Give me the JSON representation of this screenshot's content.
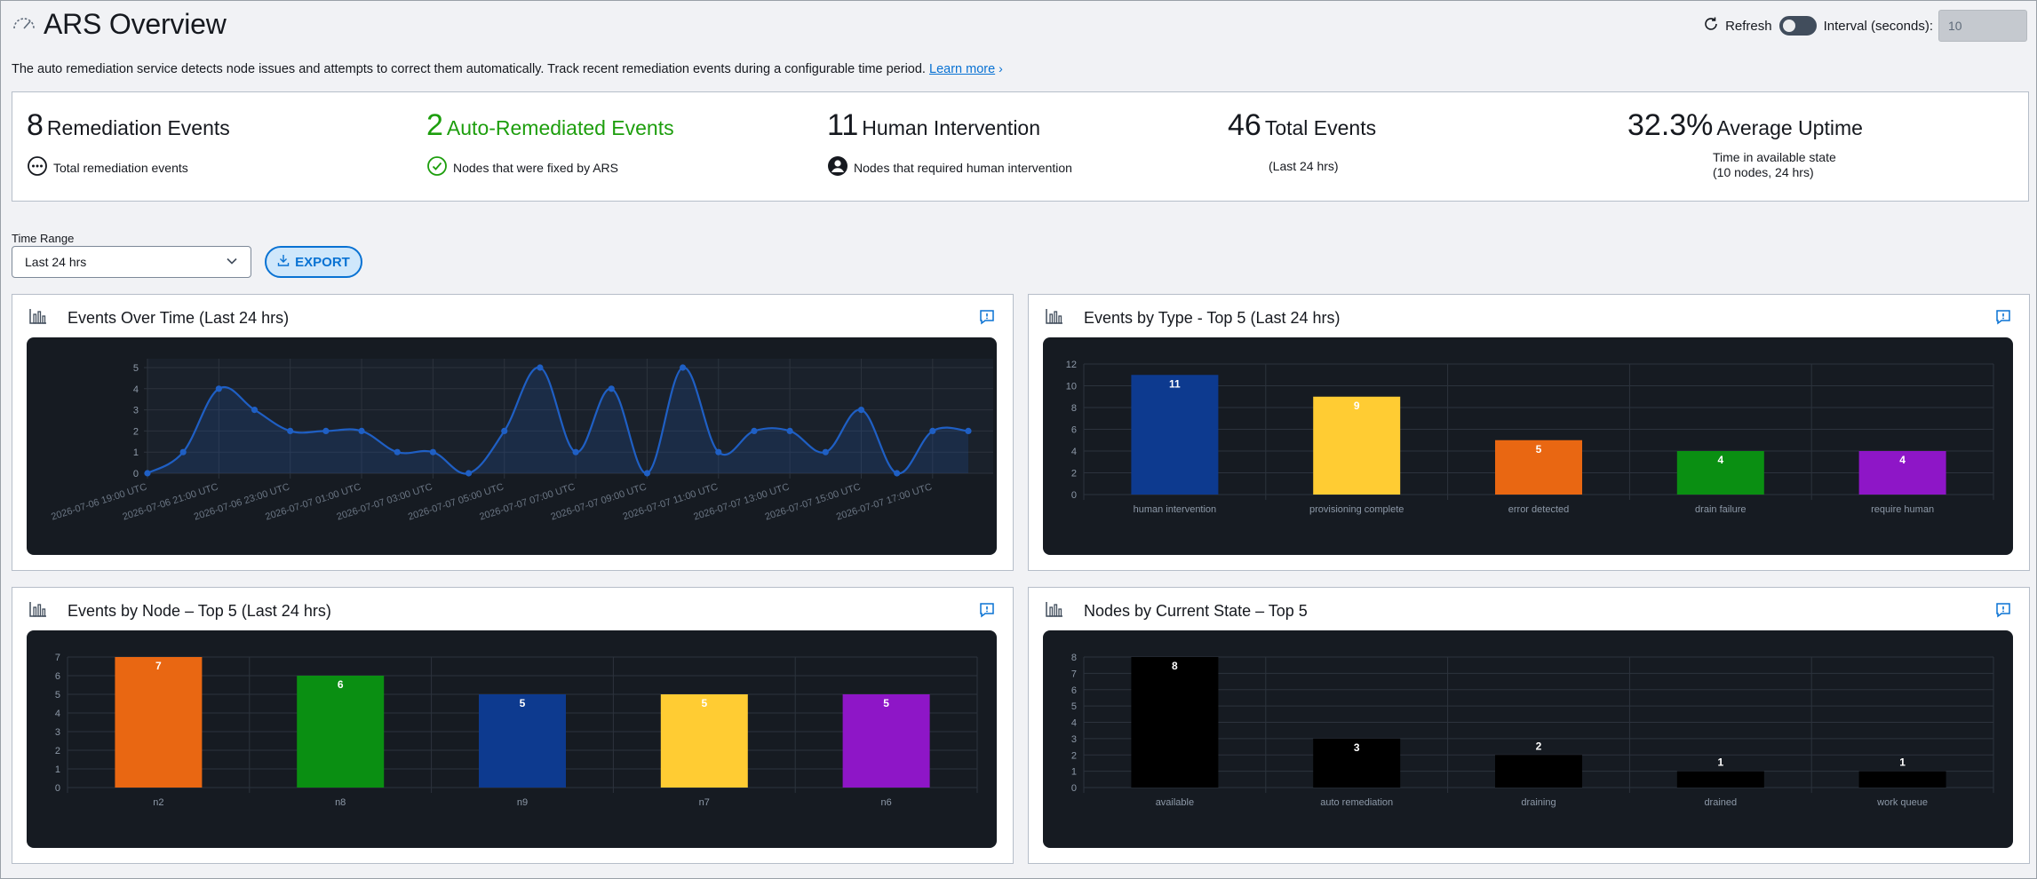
{
  "header": {
    "title": "ARS Overview",
    "refresh_label": "Refresh",
    "interval_label": "Interval (seconds):",
    "interval_value": "10",
    "description": "The auto remediation service detects node issues and attempts to correct them automatically. Track recent remediation events during a configurable time period.",
    "learn_more": "Learn more",
    "learn_more_chevron": "›"
  },
  "summary": {
    "remediation": {
      "count": "8",
      "label": "Remediation Events",
      "sub": "Total remediation events",
      "icon": "ellipsis-circle-icon"
    },
    "auto": {
      "count": "2",
      "label": "Auto-Remediated Events",
      "sub": "Nodes that were fixed by ARS",
      "icon": "check-circle-icon",
      "color": "#1d9e0d"
    },
    "human": {
      "count": "11",
      "label": "Human Intervention",
      "sub": "Nodes that required human intervention",
      "icon": "user-profile-icon"
    },
    "total": {
      "count": "46",
      "label": "Total Events",
      "sub": "(Last 24 hrs)"
    },
    "uptime": {
      "count": "32.3%",
      "label": "Average Uptime",
      "sub1": "Time in available state",
      "sub2": "(10 nodes, 24 hrs)"
    }
  },
  "controls": {
    "time_range_label": "Time Range",
    "time_range_value": "Last 24 hrs",
    "export_label": "EXPORT"
  },
  "panels": {
    "events_over_time": "Events Over Time (Last 24 hrs)",
    "events_by_type": "Events by Type - Top 5 (Last 24 hrs)",
    "events_by_node": "Events by Node – Top 5 (Last 24 hrs)",
    "nodes_by_state": "Nodes by Current State – Top 5"
  },
  "chart_data": [
    {
      "type": "line",
      "title": "Events Over Time (Last 24 hrs)",
      "ylim": [
        0,
        5
      ],
      "yticks": [
        0,
        1,
        2,
        3,
        4,
        5
      ],
      "x_tick_labels": [
        "2026-07-06 19:00 UTC",
        "2026-07-06 21:00 UTC",
        "2026-07-06 23:00 UTC",
        "2026-07-07 01:00 UTC",
        "2026-07-07 03:00 UTC",
        "2026-07-07 05:00 UTC",
        "2026-07-07 07:00 UTC",
        "2026-07-07 09:00 UTC",
        "2026-07-07 11:00 UTC",
        "2026-07-07 13:00 UTC",
        "2026-07-07 15:00 UTC",
        "2026-07-07 17:00 UTC"
      ],
      "series": [
        {
          "color": "#1f5fc4",
          "values": [
            0,
            1,
            4,
            3,
            2,
            2,
            2,
            1,
            1,
            0,
            2,
            5,
            1,
            4,
            0,
            5,
            1,
            2,
            2,
            1,
            3,
            0,
            2,
            2
          ]
        }
      ],
      "grid": true
    },
    {
      "type": "bar",
      "title": "Events by Type - Top 5 (Last 24 hrs)",
      "categories": [
        "human intervention",
        "provisioning complete",
        "error detected",
        "drain failure",
        "require human"
      ],
      "values": [
        11,
        9,
        5,
        4,
        4
      ],
      "colors": [
        "#0d3a8f",
        "#ffcc33",
        "#e96712",
        "#0a8f12",
        "#8e16c7"
      ],
      "ylim": [
        0,
        12
      ],
      "yticks": [
        0,
        2,
        4,
        6,
        8,
        10,
        12
      ],
      "grid": true
    },
    {
      "type": "bar",
      "title": "Events by Node – Top 5 (Last 24 hrs)",
      "categories": [
        "n2",
        "n8",
        "n9",
        "n7",
        "n6"
      ],
      "values": [
        7,
        6,
        5,
        5,
        5
      ],
      "colors": [
        "#e96712",
        "#0a8f12",
        "#0d3a8f",
        "#ffcc33",
        "#8e16c7"
      ],
      "ylim": [
        0,
        7
      ],
      "yticks": [
        0,
        1,
        2,
        3,
        4,
        5,
        6,
        7
      ],
      "grid": true
    },
    {
      "type": "bar",
      "title": "Nodes by Current State – Top 5",
      "categories": [
        "available",
        "auto remediation",
        "draining",
        "drained",
        "work queue"
      ],
      "values": [
        8,
        3,
        2,
        1,
        1
      ],
      "colors": [
        "#000000",
        "#000000",
        "#000000",
        "#000000",
        "#000000"
      ],
      "ylim": [
        0,
        8
      ],
      "yticks": [
        0,
        1,
        2,
        3,
        4,
        5,
        6,
        7,
        8
      ],
      "grid": true
    }
  ]
}
